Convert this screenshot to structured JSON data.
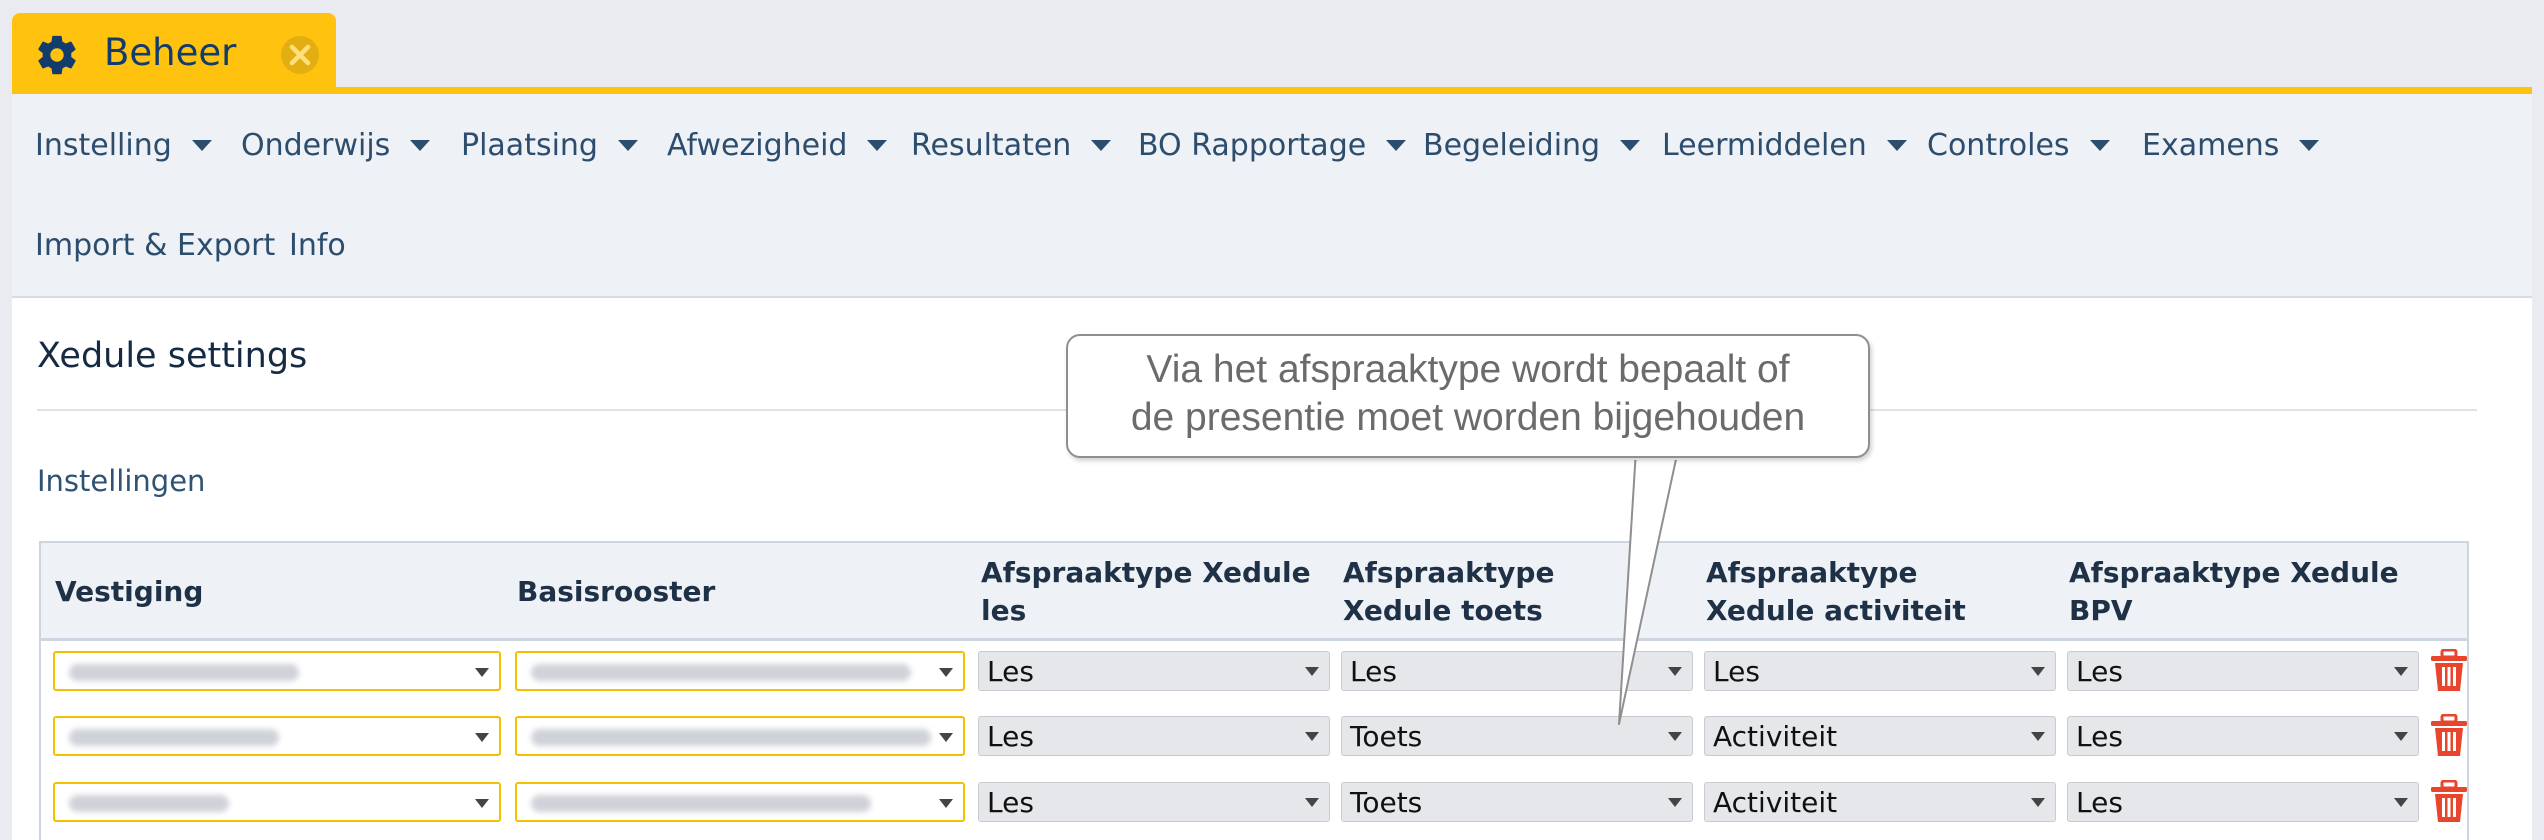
{
  "tab": {
    "label": "Beheer",
    "icon": "gear-icon",
    "close_icon": "close-icon",
    "accent": "#ffc20e"
  },
  "menu": {
    "items": [
      {
        "label": "Instelling",
        "has_dropdown": true
      },
      {
        "label": "Onderwijs",
        "has_dropdown": true
      },
      {
        "label": "Plaatsing",
        "has_dropdown": true
      },
      {
        "label": "Afwezigheid",
        "has_dropdown": true
      },
      {
        "label": "Resultaten",
        "has_dropdown": true
      },
      {
        "label": "BO Rapportage",
        "has_dropdown": true
      },
      {
        "label": "Begeleiding",
        "has_dropdown": true
      },
      {
        "label": "Leermiddelen",
        "has_dropdown": true
      },
      {
        "label": "Controles",
        "has_dropdown": true
      },
      {
        "label": "Examens",
        "has_dropdown": true
      },
      {
        "label": "Import & Export",
        "has_dropdown": false
      },
      {
        "label": "Info",
        "has_dropdown": false
      }
    ]
  },
  "page": {
    "title": "Xedule settings",
    "section": "Instellingen"
  },
  "table": {
    "columns": [
      "Vestiging",
      "Basisrooster",
      "Afspraaktype Xedule les",
      "Afspraaktype Xedule toets",
      "Afspraaktype Xedule activiteit",
      "Afspraaktype Xedule BPV"
    ],
    "rows": [
      {
        "les": "Les",
        "toets": "Les",
        "activiteit": "Les",
        "bpv": "Les"
      },
      {
        "les": "Les",
        "toets": "Toets",
        "activiteit": "Activiteit",
        "bpv": "Les"
      },
      {
        "les": "Les",
        "toets": "Toets",
        "activiteit": "Activiteit",
        "bpv": "Les"
      }
    ],
    "delete_icon": "trash-icon",
    "delete_color": "#e8452c"
  },
  "callout": {
    "line1": "Via het afspraaktype wordt bepaalt of",
    "line2": "de presentie moet worden bijgehouden"
  }
}
